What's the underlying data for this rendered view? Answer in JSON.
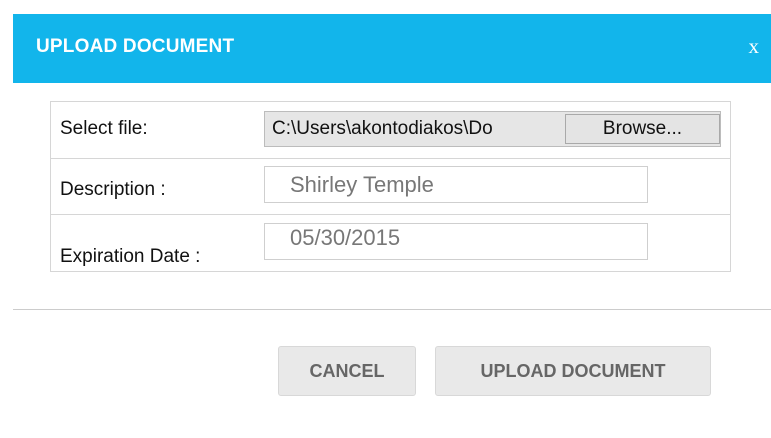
{
  "dialog": {
    "title": "UPLOAD DOCUMENT",
    "close_label": "x"
  },
  "form": {
    "file": {
      "label": "Select file:",
      "path": "C:\\Users\\akontodiakos\\Do",
      "browse_label": "Browse..."
    },
    "description": {
      "label": "Description :",
      "value": "Shirley Temple"
    },
    "expiration": {
      "label": "Expiration Date :",
      "value": "05/30/2015"
    }
  },
  "actions": {
    "cancel_label": "CANCEL",
    "upload_label": "UPLOAD DOCUMENT"
  },
  "colors": {
    "header_bg": "#12b5eb",
    "button_bg": "#e9e9e9"
  }
}
